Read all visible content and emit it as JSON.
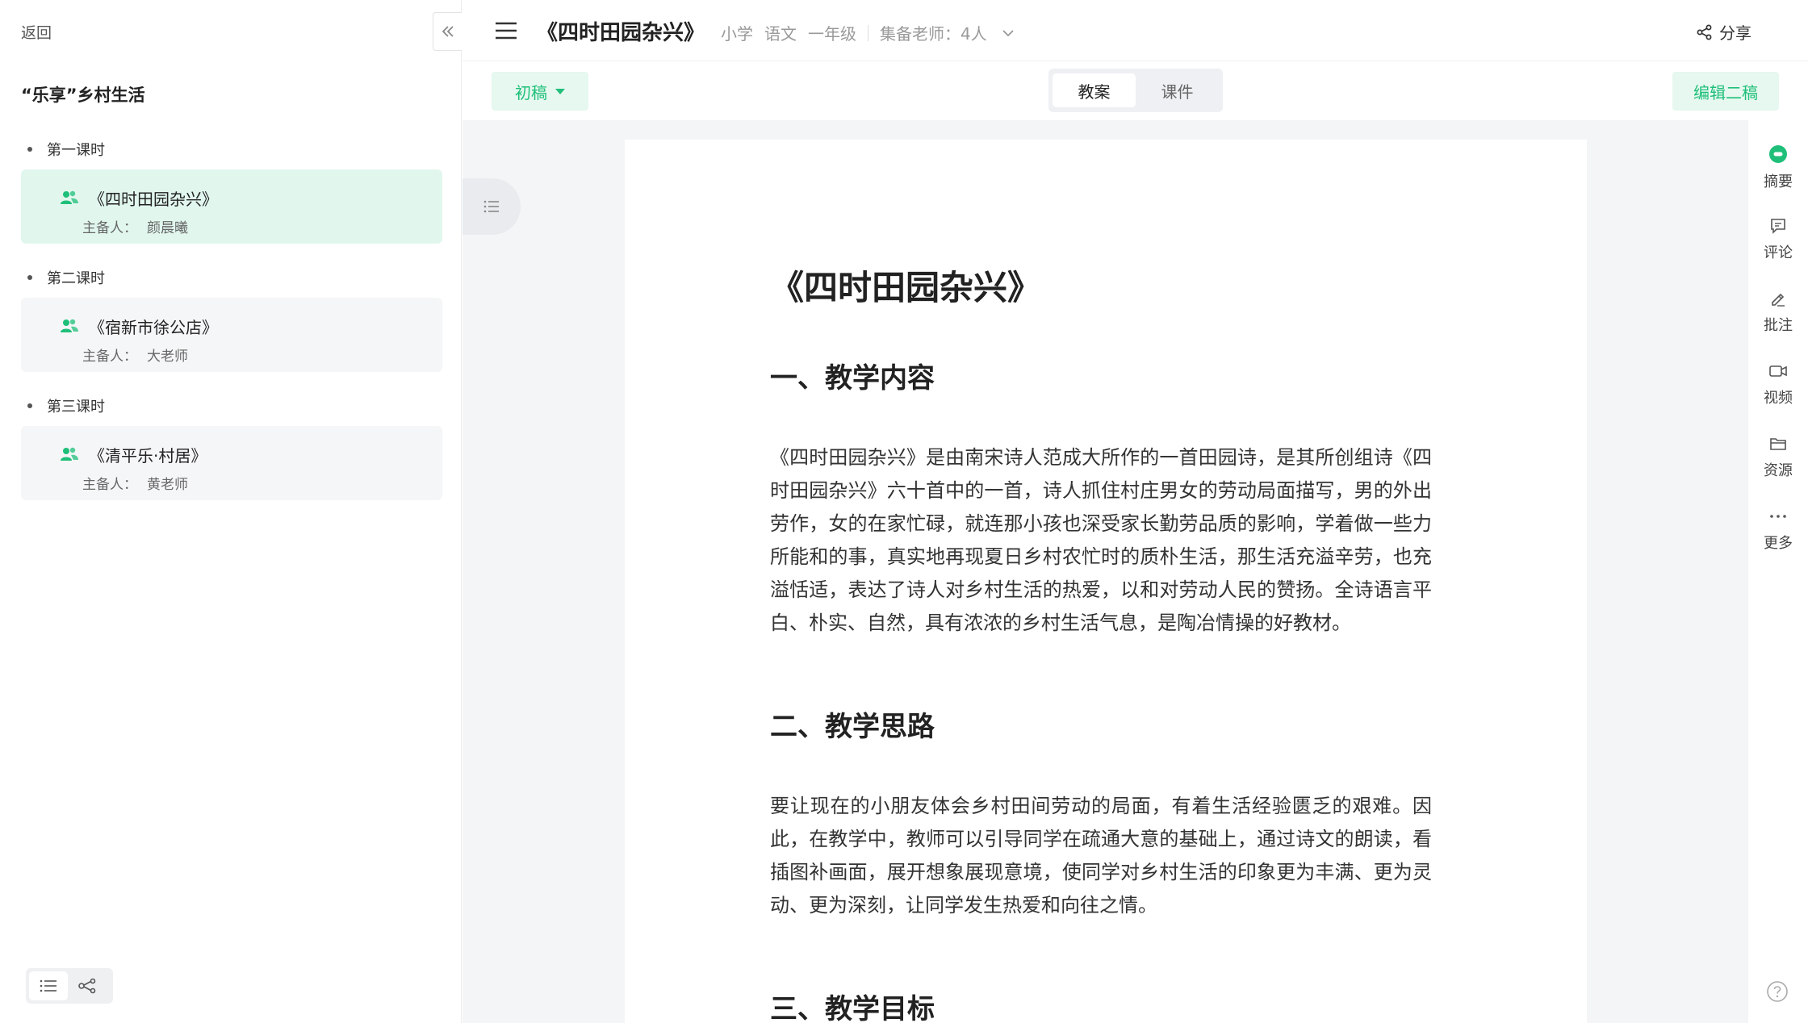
{
  "sidebar": {
    "back_label": "返回",
    "unit_title": "“乐享”乡村生活",
    "groups": [
      {
        "heading": "第一课时",
        "lesson": "《四时田园杂兴》",
        "owner_label": "主备人：",
        "owner": "颜晨曦",
        "active": true
      },
      {
        "heading": "第二课时",
        "lesson": "《宿新市徐公店》",
        "owner_label": "主备人：",
        "owner": "大老师",
        "active": false
      },
      {
        "heading": "第三课时",
        "lesson": "《清平乐·村居》",
        "owner_label": "主备人：",
        "owner": "黄老师",
        "active": false
      }
    ]
  },
  "header": {
    "title": "《四时田园杂兴》",
    "school_level": "小学",
    "subject": "语文",
    "grade": "一年级",
    "teachers_label": "集备老师：4人",
    "share_label": "分享"
  },
  "toolbar": {
    "draft_label": "初稿",
    "tabs": [
      "教案",
      "课件"
    ],
    "active_tab": "教案",
    "edit_label": "编辑二稿"
  },
  "document": {
    "title": "《四时田园杂兴》",
    "sections": [
      {
        "heading": "一、教学内容",
        "body": "《四时田园杂兴》是由南宋诗人范成大所作的一首田园诗，是其所创组诗《四时田园杂兴》六十首中的一首，诗人抓住村庄男女的劳动局面描写，男的外出劳作，女的在家忙碌，就连那小孩也深受家长勤劳品质的影响，学着做一些力所能和的事，真实地再现夏日乡村农忙时的质朴生活，那生活充溢辛劳，也充溢恬适，表达了诗人对乡村生活的热爱，以和对劳动人民的赞扬。全诗语言平白、朴实、自然，具有浓浓的乡村生活气息，是陶冶情操的好教材。"
      },
      {
        "heading": "二、教学思路",
        "body": "要让现在的小朋友体会乡村田间劳动的局面，有着生活经验匮乏的艰难。因此，在教学中，教师可以引导同学在疏通大意的基础上，通过诗文的朗读，看插图补画面，展开想象展现意境，使同学对乡村生活的印象更为丰满、更为灵动、更为深刻，让同学发生热爱和向往之情。"
      },
      {
        "heading": "三、教学目标",
        "body": ""
      }
    ]
  },
  "rail": {
    "items": [
      "摘要",
      "评论",
      "批注",
      "视频",
      "资源",
      "更多"
    ]
  },
  "colors": {
    "accent": "#1fbf7a",
    "accent_bg": "#e6f8ef",
    "active_card_bg": "#e1f7ee"
  }
}
